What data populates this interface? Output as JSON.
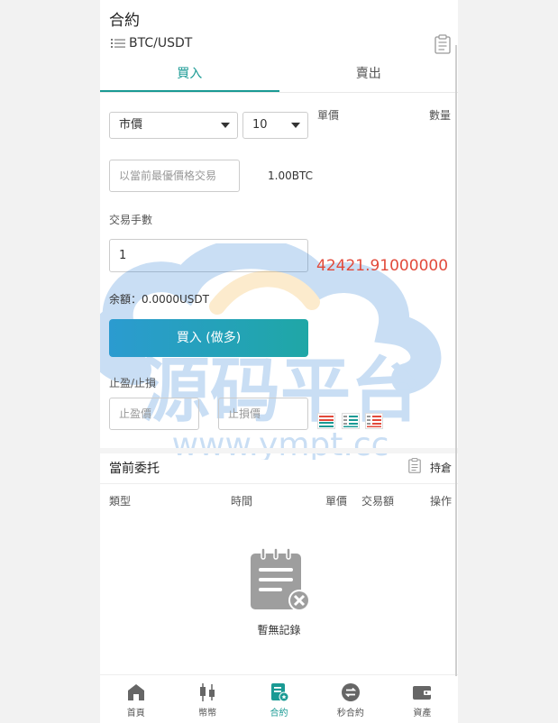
{
  "header": {
    "title": "合約",
    "pair": "BTC/USDT"
  },
  "tabs": [
    {
      "label": "買入",
      "active": true
    },
    {
      "label": "賣出",
      "active": false
    }
  ],
  "order": {
    "type_select": "市價",
    "leverage_select": "10",
    "price_header": "單價",
    "qty_header": "數量",
    "market_price_placeholder": "以當前最優價格交易",
    "btc_amount": "1.00BTC",
    "lots_label": "交易手數",
    "lots_value": "1",
    "last_price": "42421.91000000",
    "balance": "余額：0.0000USDT",
    "buy_button": "買入 (做多)",
    "tp_sl_label": "止盈/止損",
    "tp_placeholder": "止盈價",
    "sl_placeholder": "止損價"
  },
  "watermark": {
    "text_cn": "源码平台",
    "text_url": "www.ympt.cc"
  },
  "current_orders": {
    "title": "當前委托",
    "positions_label": "持倉",
    "columns": [
      "類型",
      "時間",
      "單價",
      "交易額",
      "操作"
    ],
    "empty_text": "暫無記錄"
  },
  "nav": [
    {
      "label": "首頁",
      "icon": "home-icon",
      "active": false
    },
    {
      "label": "幣幣",
      "icon": "candlestick-icon",
      "active": false
    },
    {
      "label": "合約",
      "icon": "contract-icon",
      "active": true
    },
    {
      "label": "秒合約",
      "icon": "exchange-icon",
      "active": false
    },
    {
      "label": "資產",
      "icon": "wallet-icon",
      "active": false
    }
  ],
  "colors": {
    "accent": "#1a9a94",
    "price_red": "#e24a3b"
  }
}
